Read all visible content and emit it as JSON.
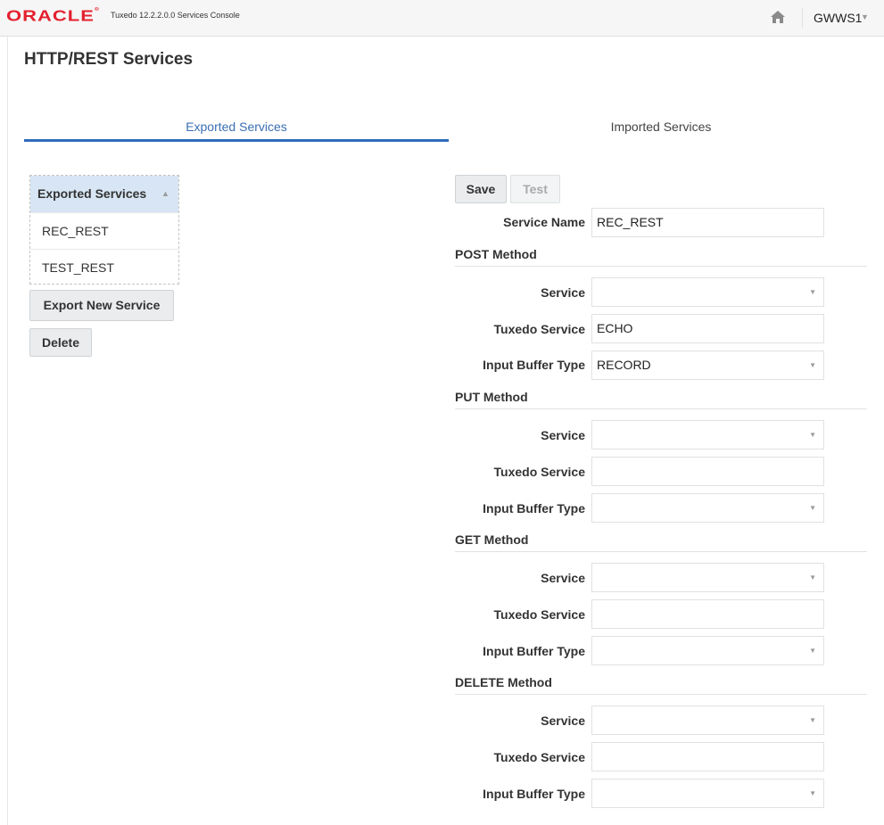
{
  "header": {
    "logo": "ORACLE",
    "title": "Tuxedo 12.2.2.0.0 Services Console",
    "home_icon": "home-icon",
    "user": "GWWS1"
  },
  "page": {
    "title": "HTTP/REST Services"
  },
  "tabs": [
    {
      "label": "Exported Services",
      "selected": true
    },
    {
      "label": "Imported Services",
      "selected": false
    }
  ],
  "services_list": {
    "header": "Exported Services",
    "items": [
      "REC_REST",
      "TEST_REST"
    ]
  },
  "buttons": {
    "export": "Export New Service",
    "delete": "Delete",
    "save": "Save",
    "test": "Test"
  },
  "form": {
    "service_name_label": "Service Name",
    "service_name_value": "REC_REST",
    "methods": [
      {
        "title": "POST Method",
        "service_label": "Service",
        "service_value": "",
        "tuxedo_label": "Tuxedo Service",
        "tuxedo_value": "ECHO",
        "buffer_label": "Input Buffer Type",
        "buffer_value": "RECORD"
      },
      {
        "title": "PUT Method",
        "service_label": "Service",
        "service_value": "",
        "tuxedo_label": "Tuxedo Service",
        "tuxedo_value": "",
        "buffer_label": "Input Buffer Type",
        "buffer_value": ""
      },
      {
        "title": "GET Method",
        "service_label": "Service",
        "service_value": "",
        "tuxedo_label": "Tuxedo Service",
        "tuxedo_value": "",
        "buffer_label": "Input Buffer Type",
        "buffer_value": ""
      },
      {
        "title": "DELETE Method",
        "service_label": "Service",
        "service_value": "",
        "tuxedo_label": "Tuxedo Service",
        "tuxedo_value": "",
        "buffer_label": "Input Buffer Type",
        "buffer_value": ""
      }
    ]
  },
  "colors": {
    "accent": "#2f6bbd",
    "brand": "#e4202e",
    "list_header": "#d7e5f4"
  }
}
